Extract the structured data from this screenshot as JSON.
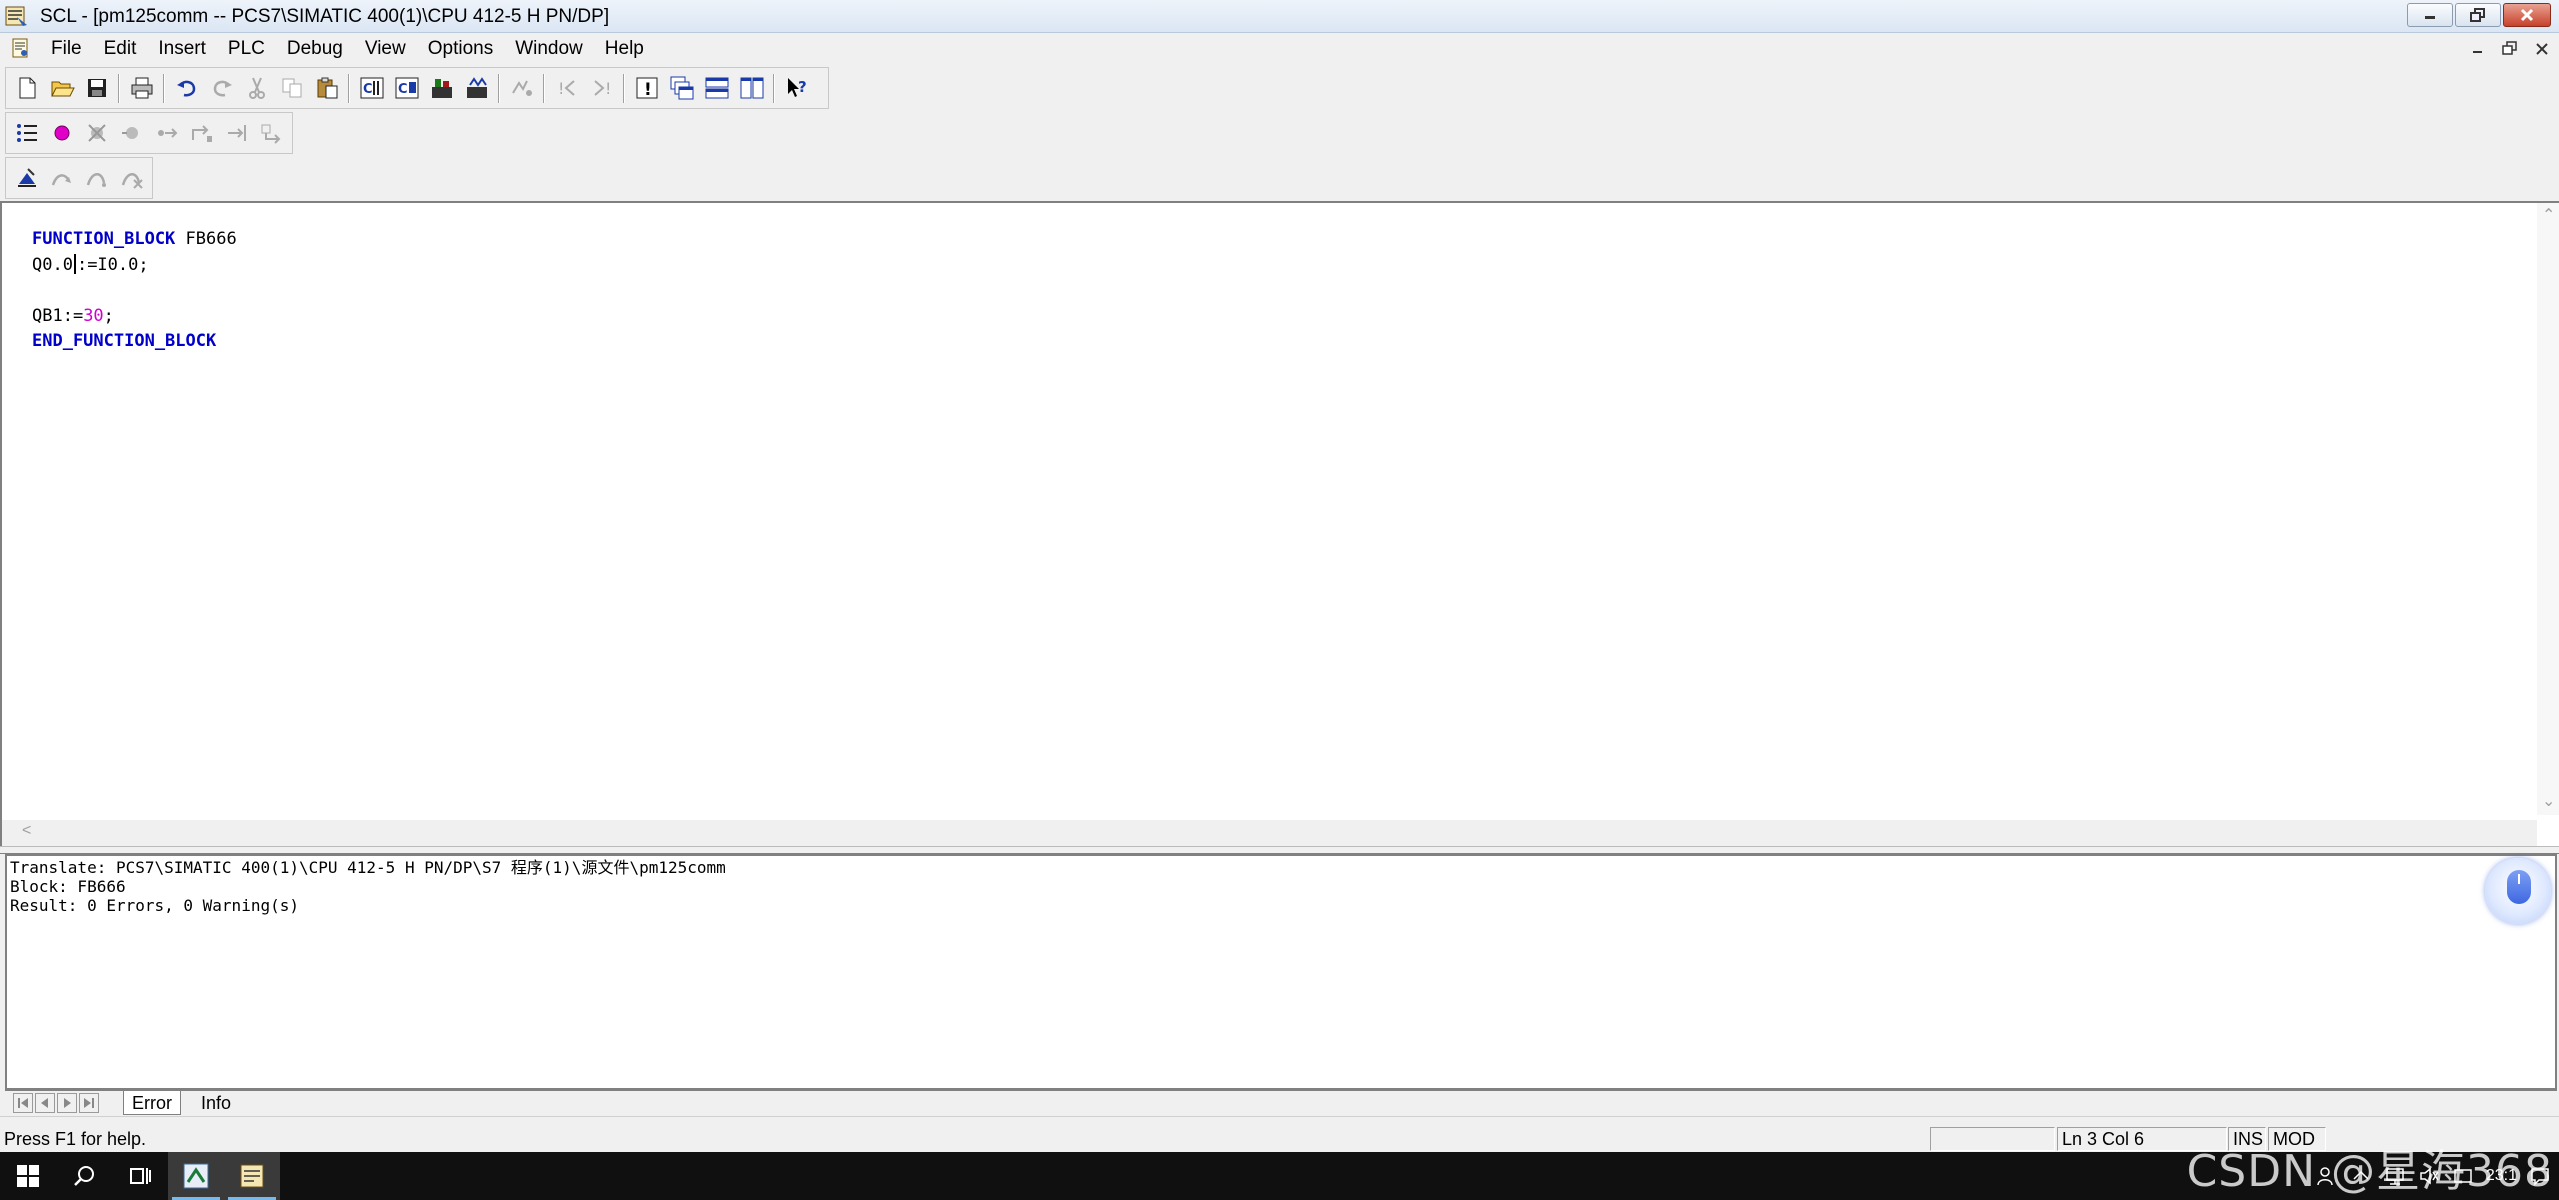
{
  "window": {
    "title": "SCL  - [pm125comm -- PCS7\\SIMATIC 400(1)\\CPU 412-5 H PN/DP]",
    "app_icon": "scl-app-icon",
    "controls": [
      "minimize-icon",
      "restore-icon",
      "close-icon"
    ]
  },
  "menu": {
    "items": [
      "File",
      "Edit",
      "Insert",
      "PLC",
      "Debug",
      "View",
      "Options",
      "Window",
      "Help"
    ],
    "mdi_controls": [
      "mdi-minimize-icon",
      "mdi-restore-icon",
      "mdi-close-icon"
    ]
  },
  "toolbar1": {
    "buttons": [
      "new-icon",
      "open-icon",
      "save-icon",
      "print-icon",
      "undo-icon",
      "redo-icon",
      "cut-icon",
      "copy-icon",
      "paste-icon",
      "compile-icon",
      "compile-all-icon",
      "download-icon",
      "monitor-icon",
      "breakpoint-icon",
      "go-to-icon",
      "previous-error-icon",
      "next-error-icon",
      "message-icon",
      "cascade-icon",
      "tile-horizontal-icon",
      "tile-vertical-icon",
      "context-help-icon"
    ]
  },
  "toolbar2": {
    "buttons": [
      "list-icon",
      "breakpoint-set-icon",
      "delete-breakpoint-icon",
      "disable-breakpoint-icon",
      "step-icon",
      "step-into-icon",
      "step-out-icon",
      "run-to-cursor-icon"
    ]
  },
  "toolbar3": {
    "buttons": [
      "monitor-continuous-icon",
      "debug-step-icon",
      "debug-next-icon",
      "debug-stop-icon"
    ]
  },
  "editor": {
    "lines": [
      {
        "parts": [
          {
            "text": "FUNCTION_BLOCK",
            "style": "kw"
          },
          {
            "text": " FB666",
            "style": ""
          }
        ]
      },
      {
        "parts": [
          {
            "text": "Q0.0",
            "style": ""
          },
          {
            "caret": true
          },
          {
            "text": ":=I0.0;",
            "style": ""
          }
        ]
      },
      {
        "parts": []
      },
      {
        "parts": [
          {
            "text": "QB1:=",
            "style": ""
          },
          {
            "text": "30",
            "style": "num"
          },
          {
            "text": ";",
            "style": ""
          }
        ]
      },
      {
        "parts": [
          {
            "text": "END_FUNCTION_BLOCK",
            "style": "kw"
          }
        ]
      }
    ]
  },
  "output": {
    "lines": [
      "Translate: PCS7\\SIMATIC 400(1)\\CPU 412-5 H PN/DP\\S7 程序(1)\\源文件\\pm125comm",
      "Block: FB666",
      "Result: 0 Errors, 0 Warning(s)"
    ]
  },
  "tabs": {
    "active": "Error",
    "inactive": "Info"
  },
  "status": {
    "help": "Press F1 for help.",
    "position": "Ln 3 Col 6",
    "ins": "INS",
    "mod": "MOD"
  },
  "taskbar": {
    "clock_partial": "23:1",
    "watermark": "CSDN @星海368"
  }
}
